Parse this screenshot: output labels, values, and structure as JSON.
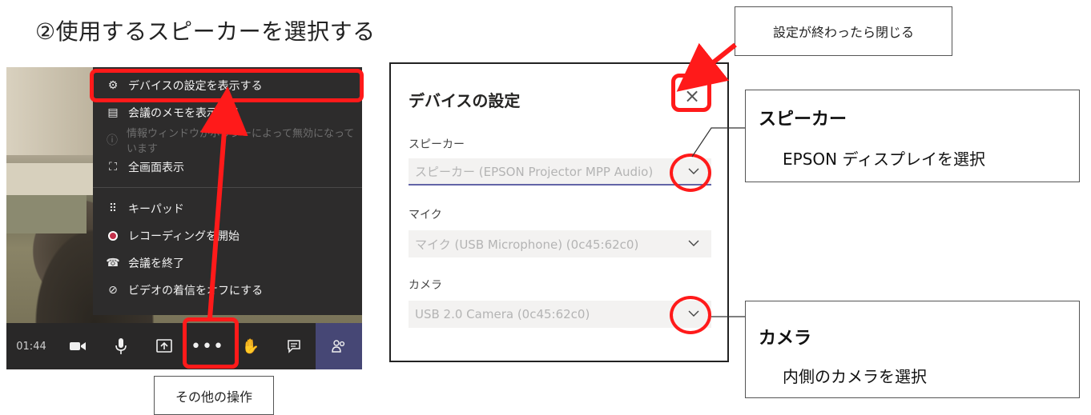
{
  "heading": "②使用するスピーカーを選択する",
  "menu": {
    "items": [
      {
        "icon": "gear-icon",
        "glyph": "⚙",
        "label": "デバイスの設定を表示する"
      },
      {
        "icon": "notes-icon",
        "glyph": "▤",
        "label": "会議のメモを表示する"
      },
      {
        "icon": "info-icon",
        "glyph": "ⓘ",
        "label": "情報ウィンドウがポリシーによって無効になっています"
      },
      {
        "icon": "fullscreen-icon",
        "glyph": "⛶",
        "label": "全画面表示"
      },
      {
        "icon": "keypad-icon",
        "glyph": "⠿",
        "label": "キーパッド"
      },
      {
        "icon": "record-icon",
        "glyph": "",
        "label": "レコーディングを開始"
      },
      {
        "icon": "hangup-icon",
        "glyph": "☎",
        "label": "会議を終了"
      },
      {
        "icon": "video-off-icon",
        "glyph": "⊘",
        "label": "ビデオの着信をオフにする"
      }
    ]
  },
  "toolbar": {
    "time": "01:44"
  },
  "callouts": {
    "more_actions": "その他の操作",
    "close_when_done": "設定が終わったら閉じる"
  },
  "settings": {
    "title": "デバイスの設定",
    "close_glyph": "×",
    "speaker_label": "スピーカー",
    "speaker_value": "スピーカー (EPSON Projector MPP Audio)",
    "mic_label": "マイク",
    "mic_value": "マイク (USB Microphone) (0c45:62c0)",
    "camera_label": "カメラ",
    "camera_value": "USB 2.0 Camera (0c45:62c0)"
  },
  "speaker_note": {
    "title": "スピーカー",
    "desc": "EPSON ディスプレイを選択"
  },
  "camera_note": {
    "title": "カメラ",
    "desc": "内側のカメラを選択"
  },
  "colors": {
    "highlight": "#ff1a1a",
    "menu_bg": "#2d2c2c",
    "accent": "#6264a7"
  }
}
